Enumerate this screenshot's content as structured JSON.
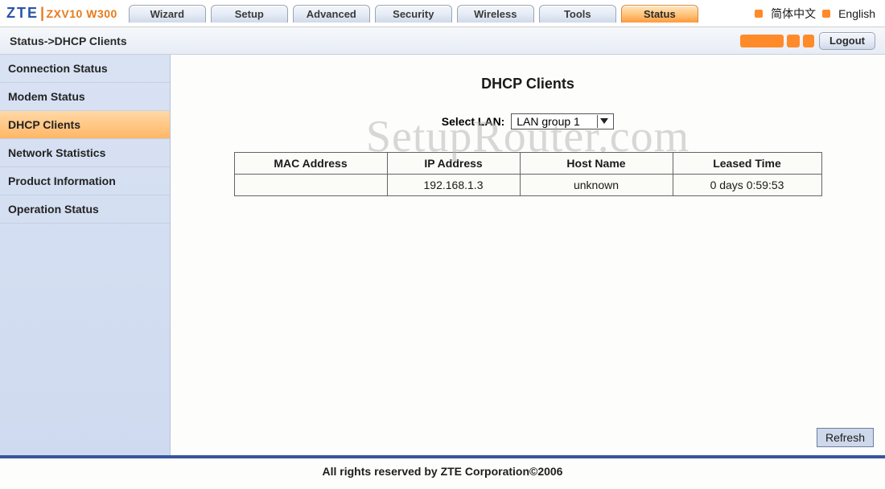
{
  "brand": {
    "logo": "ZTE",
    "model": "ZXV10 W300"
  },
  "nav": {
    "tabs": [
      {
        "label": "Wizard",
        "active": false
      },
      {
        "label": "Setup",
        "active": false
      },
      {
        "label": "Advanced",
        "active": false
      },
      {
        "label": "Security",
        "active": false
      },
      {
        "label": "Wireless",
        "active": false
      },
      {
        "label": "Tools",
        "active": false
      },
      {
        "label": "Status",
        "active": true
      }
    ]
  },
  "lang": {
    "chinese": "简体中文",
    "english": "English"
  },
  "subhead": {
    "breadcrumb": "Status->DHCP Clients",
    "logout": "Logout"
  },
  "sidebar": {
    "items": [
      {
        "label": "Connection Status",
        "active": false
      },
      {
        "label": "Modem Status",
        "active": false
      },
      {
        "label": "DHCP Clients",
        "active": true
      },
      {
        "label": "Network Statistics",
        "active": false
      },
      {
        "label": "Product Information",
        "active": false
      },
      {
        "label": "Operation Status",
        "active": false
      }
    ]
  },
  "page": {
    "title": "DHCP Clients",
    "select_label": "Select LAN:",
    "select_value": "LAN group 1",
    "refresh": "Refresh"
  },
  "table": {
    "headers": {
      "mac": "MAC Address",
      "ip": "IP Address",
      "host": "Host Name",
      "lease": "Leased Time"
    },
    "rows": [
      {
        "mac": "",
        "ip": "192.168.1.3",
        "host": "unknown",
        "lease": "0 days 0:59:53"
      }
    ]
  },
  "watermark": "SetupRouter.com",
  "footer": "All rights reserved by ZTE Corporation©2006"
}
